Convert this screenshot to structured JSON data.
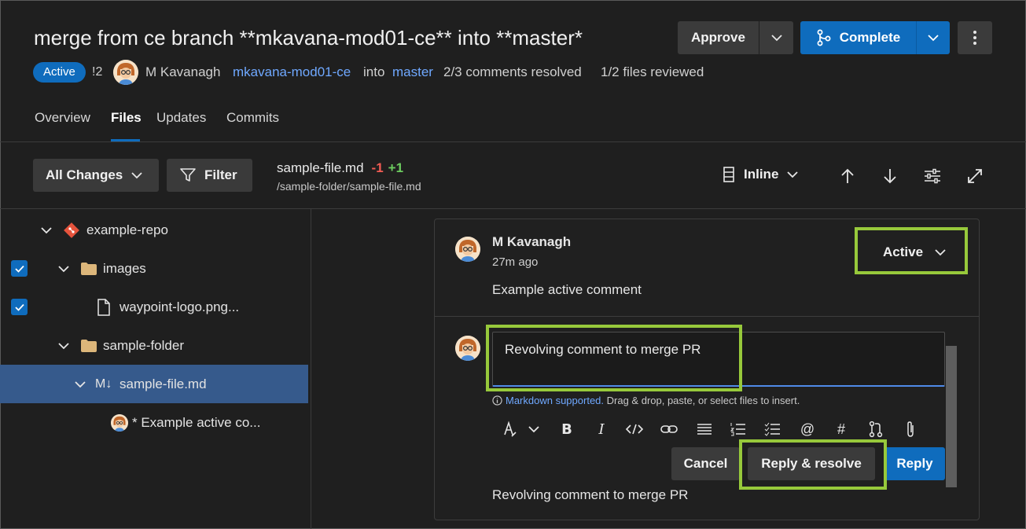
{
  "header": {
    "title": "merge from ce branch **mkavana-mod01-ce** into **master*",
    "status": "Active",
    "pr_id": "!2",
    "author": "M Kavanagh",
    "source_branch": "mkavana-mod01-ce",
    "into": "into",
    "target_branch": "master",
    "comments_resolved": "2/3 comments resolved",
    "files_reviewed": "1/2 files reviewed",
    "approve_label": "Approve",
    "complete_label": "Complete"
  },
  "tabs": [
    {
      "label": "Overview"
    },
    {
      "label": "Files",
      "selected": true
    },
    {
      "label": "Updates"
    },
    {
      "label": "Commits"
    }
  ],
  "toolbar": {
    "all_changes_label": "All Changes",
    "filter_label": "Filter",
    "file_name": "sample-file.md",
    "deletions": "-1",
    "additions": "+1",
    "file_path": "/sample-folder/sample-file.md",
    "view_mode": "Inline"
  },
  "tree": [
    {
      "label": "example-repo"
    },
    {
      "label": "images"
    },
    {
      "label": "waypoint-logo.png..."
    },
    {
      "label": "sample-folder"
    },
    {
      "label": "sample-file.md",
      "prefix": "M↓"
    },
    {
      "label": "* Example active co..."
    }
  ],
  "thread": {
    "author": "M Kavanagh",
    "time": "27m ago",
    "comment": "Example active comment",
    "status": "Active",
    "reply_text": "Revolving comment to merge PR",
    "markdown_link": "Markdown supported.",
    "markdown_hint": "Drag & drop, paste, or select files to insert.",
    "cancel_label": "Cancel",
    "reply_resolve_label": "Reply & resolve",
    "reply_label": "Reply",
    "preview_text": "Revolving comment to merge PR"
  },
  "colors": {
    "accent": "#0f6cbd",
    "highlight": "#97c93b",
    "deletion": "#f25c54",
    "addition": "#6ccb5f",
    "selected_row": "#365a8c"
  }
}
